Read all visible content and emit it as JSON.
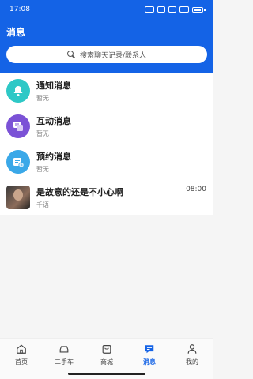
{
  "status": {
    "time": "17:08"
  },
  "header": {
    "title": "消息"
  },
  "search": {
    "placeholder": "搜索聊天记录/联系人"
  },
  "messages": [
    {
      "name": "通知消息",
      "sub": "暂无",
      "icon": "bell-icon",
      "color": "#2ec8c6"
    },
    {
      "name": "互动消息",
      "sub": "暂无",
      "icon": "chat-icon",
      "color": "#7b52d6"
    },
    {
      "name": "预约消息",
      "sub": "暂无",
      "icon": "calendar-clock-icon",
      "color": "#3aa8e8"
    },
    {
      "name": "是故意的还是不小心啊",
      "sub": "千语",
      "time": "08:00",
      "icon": "user-photo"
    }
  ],
  "tabs": [
    {
      "label": "首页",
      "icon": "home-icon"
    },
    {
      "label": "二手车",
      "icon": "car-icon"
    },
    {
      "label": "商城",
      "icon": "shopping-bag-icon"
    },
    {
      "label": "消息",
      "icon": "message-icon",
      "active": true
    },
    {
      "label": "我的",
      "icon": "user-icon"
    }
  ],
  "colors": {
    "brand": "#1463e6"
  }
}
